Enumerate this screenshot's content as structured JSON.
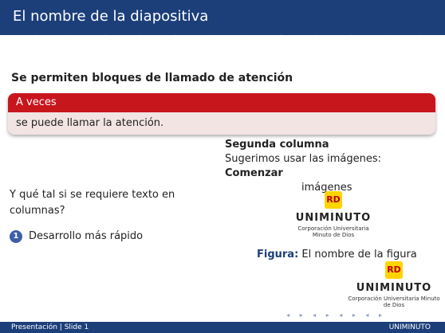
{
  "slide": {
    "title": "El nombre de la diapositiva",
    "block_title": "Se permiten bloques de llamado de atención",
    "alert": {
      "heading": "A veces",
      "body": "se puede llamar la atención."
    },
    "left": {
      "question": "Y qué tal si se requiere texto en columnas?",
      "bullet_num": "1",
      "bullet_text": "Desarrollo más rápido"
    },
    "right": {
      "heading": "Segunda columna",
      "line1": "Sugerimos usar las imágenes:",
      "line2_bold": "Comenzar",
      "line2_rest": "imágenes"
    },
    "logo_mark": "RD",
    "logo_name": "UNIMINUTO",
    "logo_sub": "Corporación Universitaria Minuto de Dios",
    "caption": {
      "label": "Figura:",
      "text": "El nombre de la figura"
    },
    "nav": "◂ ▸ ◂ ▸ ◂ ▸ ◂ ▸",
    "footer": {
      "left": "Presentación | Slide 1",
      "right": "UNIMINUTO"
    }
  },
  "colors": {
    "header": "#1c3f7a",
    "alert_head": "#c8161d",
    "alert_body": "#f3e4e4",
    "bullet": "#3d5fa8",
    "logo_yellow": "#ffd400"
  }
}
